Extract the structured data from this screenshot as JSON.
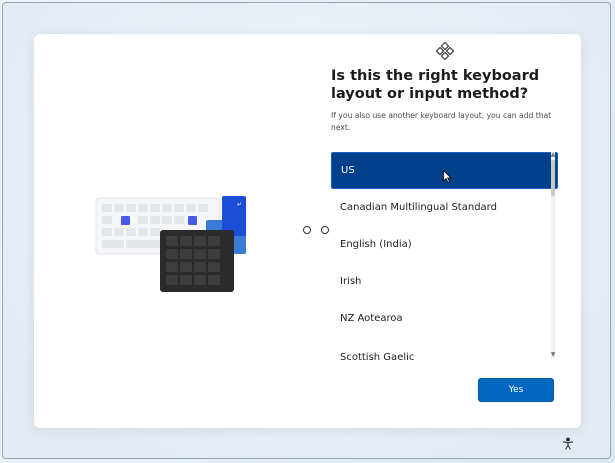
{
  "setup": {
    "title": "Is this the right keyboard layout or input method?",
    "subtitle": "If you also use another keyboard layout, you can add that next.",
    "layouts": [
      {
        "label": "US",
        "selected": true
      },
      {
        "label": "Canadian Multilingual Standard",
        "selected": false
      },
      {
        "label": "English (India)",
        "selected": false
      },
      {
        "label": "Irish",
        "selected": false
      },
      {
        "label": "NZ Aotearoa",
        "selected": false
      },
      {
        "label": "Scottish Gaelic",
        "selected": false
      }
    ],
    "yes_label": "Yes"
  },
  "icons": {
    "top": "windows-setup-logo-icon",
    "bottom_right": "accessibility-icon",
    "illustration": "keyboard-illustration"
  },
  "colors": {
    "accent": "#0067c0",
    "selected_item": "#003f8a",
    "key_accent": "#4a5ae8",
    "numpad": "#2b2b2b"
  }
}
